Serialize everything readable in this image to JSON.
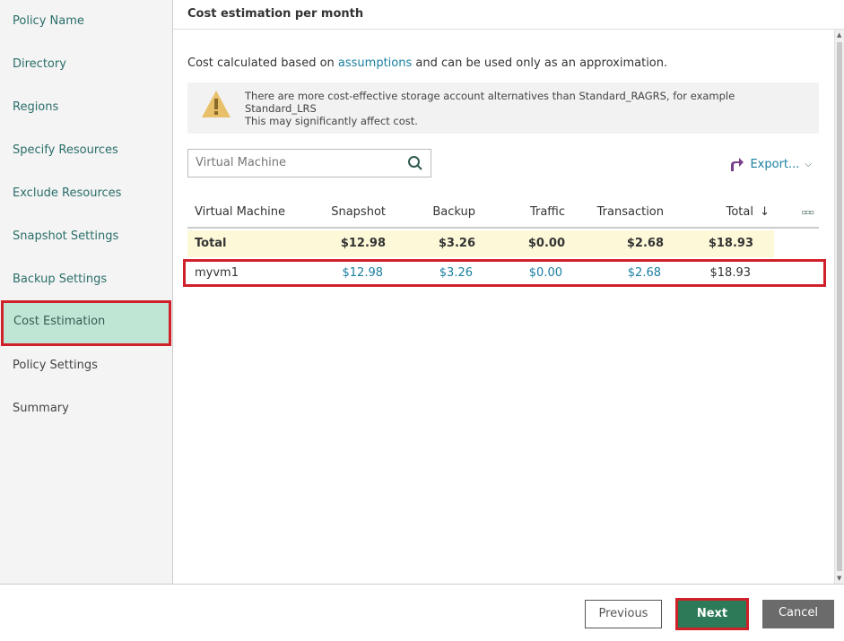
{
  "sidebar": {
    "items": [
      {
        "label": "Policy Name"
      },
      {
        "label": "Directory"
      },
      {
        "label": "Regions"
      },
      {
        "label": "Specify Resources"
      },
      {
        "label": "Exclude Resources"
      },
      {
        "label": "Snapshot Settings"
      },
      {
        "label": "Backup Settings"
      },
      {
        "label": "Cost Estimation",
        "active": true
      },
      {
        "label": "Policy Settings"
      },
      {
        "label": "Summary"
      }
    ]
  },
  "header": {
    "title": "Cost estimation per month"
  },
  "note": {
    "before": "Cost calculated based on ",
    "link": "assumptions",
    "after": " and can be used only as an approximation."
  },
  "warning": {
    "icon": "warning-icon",
    "line1": "There are more cost-effective storage account alternatives than Standard_RAGRS, for example",
    "line2": "Standard_LRS",
    "line3": "This may significantly affect cost."
  },
  "search": {
    "placeholder": "Virtual Machine"
  },
  "export": {
    "label": "Export..."
  },
  "table": {
    "columns": [
      "Virtual Machine",
      "Snapshot",
      "Backup",
      "Traffic",
      "Transaction",
      "Total"
    ],
    "sort_indicator": "↓",
    "total_row": [
      "Total",
      "$12.98",
      "$3.26",
      "$0.00",
      "$2.68",
      "$18.93"
    ],
    "rows": [
      [
        "myvm1",
        "$12.98",
        "$3.26",
        "$0.00",
        "$2.68",
        "$18.93"
      ]
    ]
  },
  "footer": {
    "previous": "Previous",
    "next": "Next",
    "cancel": "Cancel"
  }
}
